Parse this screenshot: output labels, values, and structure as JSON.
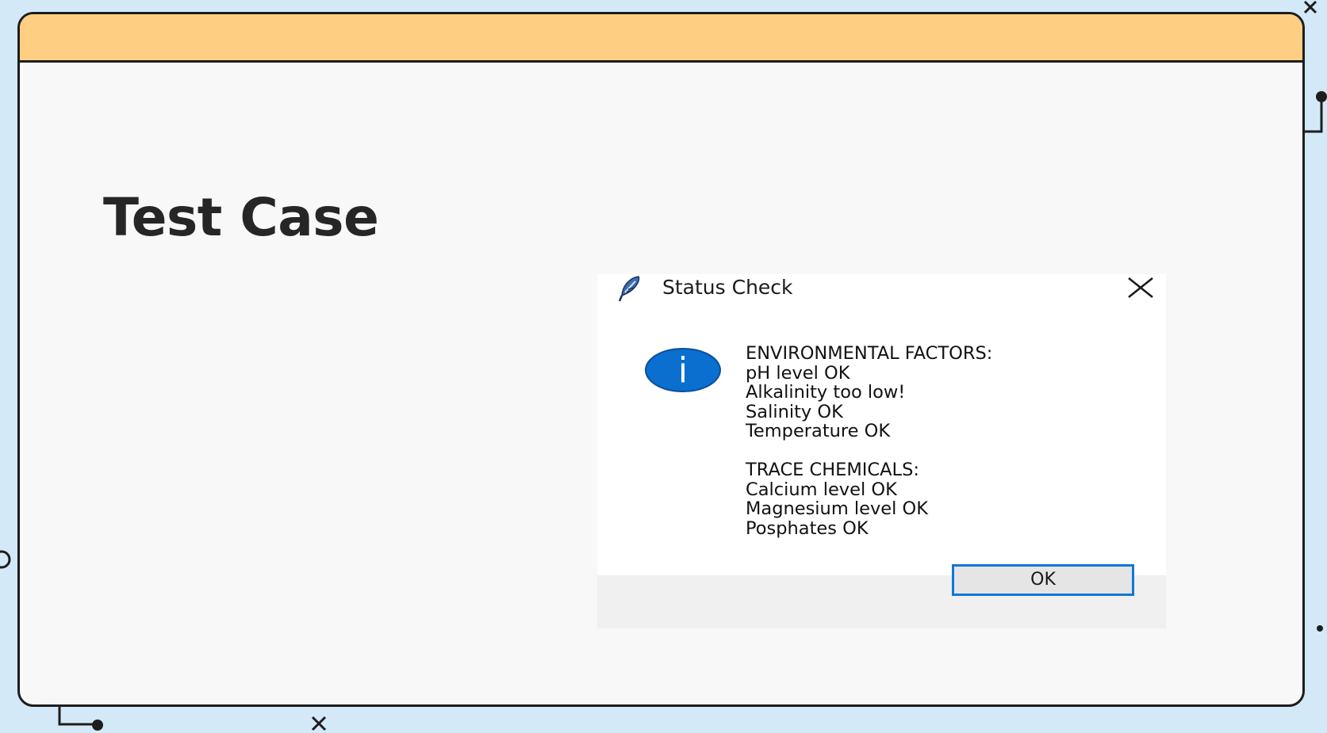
{
  "slide": {
    "heading": "Test Case"
  },
  "dialog": {
    "title": "Status Check",
    "app_icon": "feather-icon",
    "close_icon": "close-icon",
    "status_icon": "info-icon",
    "info_glyph": "i",
    "message_lines": [
      "ENVIRONMENTAL FACTORS:",
      "pH level OK",
      "Alkalinity too low!",
      "Salinity OK",
      "Temperature OK",
      "TRACE CHEMICALS:",
      "Calcium level OK",
      "Magnesium level OK",
      "Posphates OK"
    ],
    "ok_label": "OK"
  },
  "colors": {
    "background": "#d3e9f8",
    "window_titlebar": "#fece83",
    "window_body": "#f8f8f8",
    "info_blue": "#0a6fcf",
    "ok_border": "#0f78d7"
  }
}
